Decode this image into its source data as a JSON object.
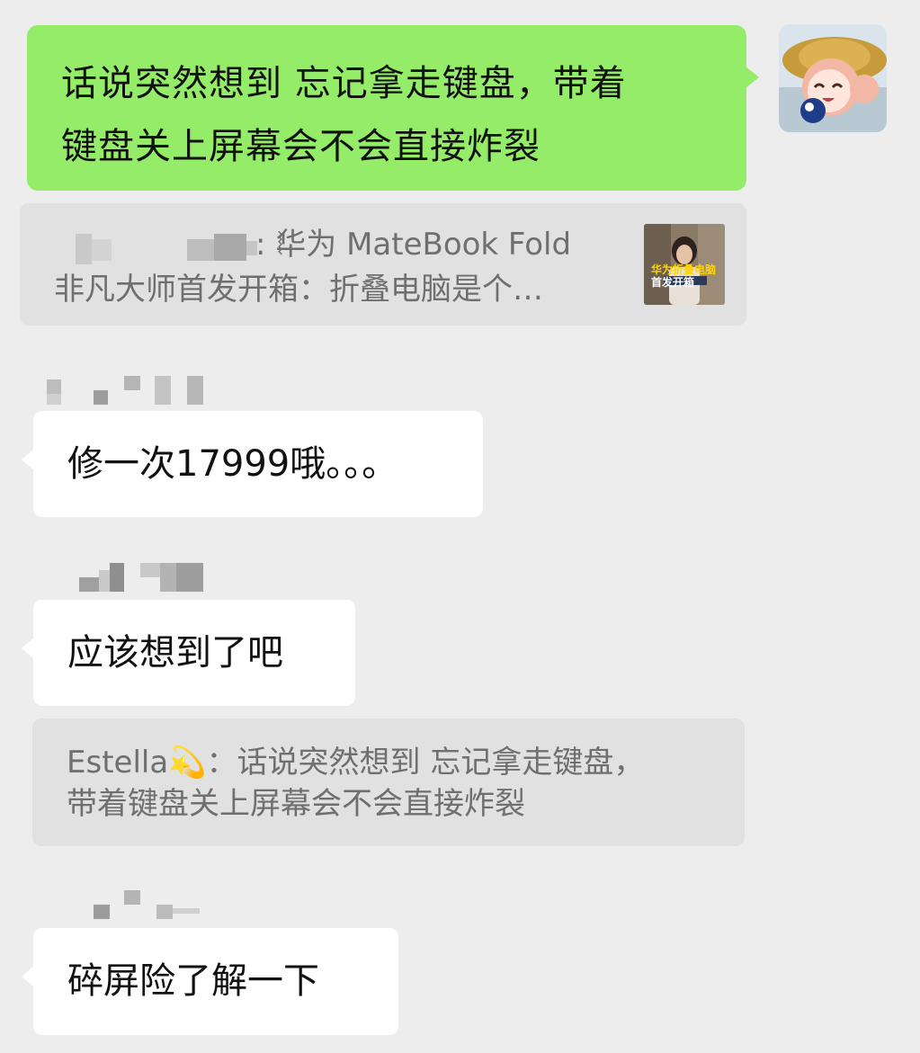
{
  "messages": {
    "outgoing": {
      "text_line1": "话说突然想到 忘记拿走键盘，带着",
      "text_line2": "键盘关上屏幕会不会直接炸裂"
    },
    "shared_link": {
      "line1": ": 华为 MateBook Fold",
      "line2": "非凡大师首发开箱：折叠电脑是个…",
      "thumbnail_caption_top": "华为折叠电脑",
      "thumbnail_caption_bottom": "首发开箱"
    },
    "incoming_1": "修一次17999哦。。。",
    "incoming_2": "应该想到了吧",
    "quote": {
      "sender": "Estella",
      "text_line1": "：话说突然想到 忘记拿走键盘，",
      "text_line2": "带着键盘关上屏幕会不会直接炸裂"
    },
    "incoming_3": "碎屏险了解一下"
  },
  "icons": {
    "avatar": "anime-girl-avatar",
    "sender_emoji": "dizzy-star-icon",
    "brand_logo": "huawei-matebook-logo-icon"
  },
  "colors": {
    "background": "#ededed",
    "outgoing_bubble": "#95ec69",
    "incoming_bubble": "#ffffff",
    "quote_bg": "#e1e1e1",
    "quote_text": "#6f6f6f"
  }
}
